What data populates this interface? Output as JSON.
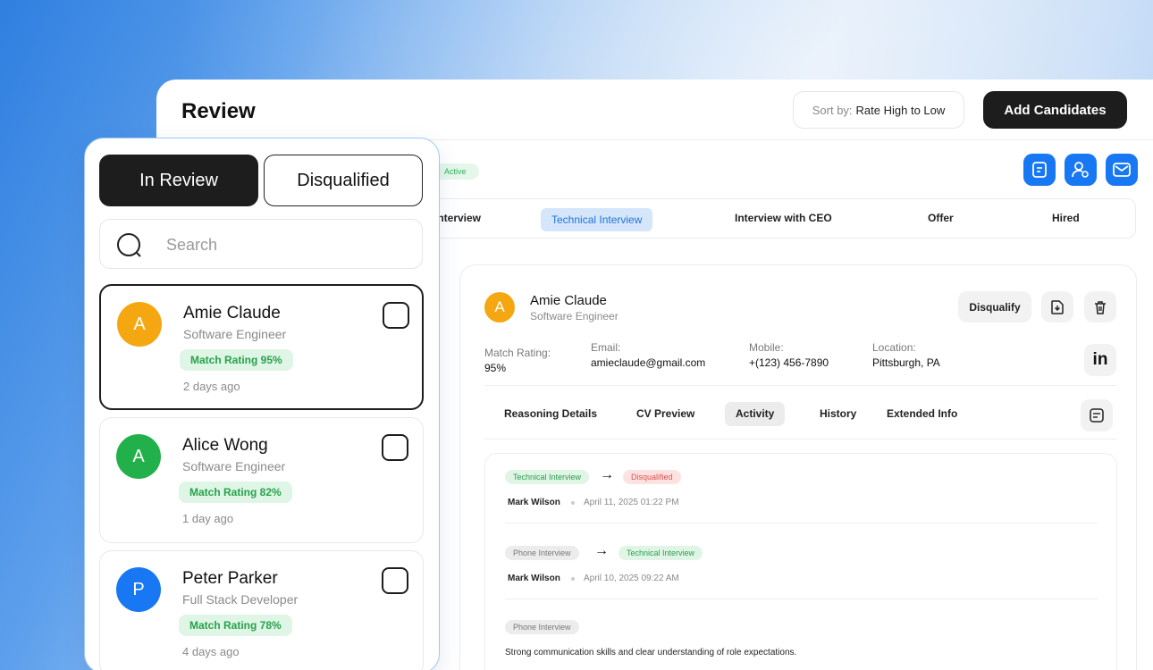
{
  "header": {
    "title": "Review",
    "sort_label": "Sort by:",
    "sort_value": "Rate High to Low",
    "add_button": "Add Candidates"
  },
  "status_badge": "Active",
  "action_icons": [
    "document-icon",
    "user-settings-icon",
    "mail-icon"
  ],
  "stages": [
    {
      "label": "Interview",
      "active": false
    },
    {
      "label": "Technical Interview",
      "active": true
    },
    {
      "label": "Interview with CEO",
      "active": false
    },
    {
      "label": "Offer",
      "active": false
    },
    {
      "label": "Hired",
      "active": false
    }
  ],
  "detail": {
    "avatar_letter": "A",
    "name": "Amie Claude",
    "role": "Software Engineer",
    "disqualify_button": "Disqualify",
    "info": [
      {
        "label": "Match Rating:",
        "value": "95%"
      },
      {
        "label": "Email:",
        "value": "amieclaude@gmail.com"
      },
      {
        "label": "Mobile:",
        "value": "+(123) 456-7890"
      },
      {
        "label": "Location:",
        "value": "Pittsburgh, PA"
      }
    ],
    "linkedin_text": "in",
    "tabs": [
      {
        "label": "Reasoning Details",
        "active": false
      },
      {
        "label": "CV Preview",
        "active": false
      },
      {
        "label": "Activity",
        "active": true
      },
      {
        "label": "History",
        "active": false
      },
      {
        "label": "Extended Info",
        "active": false
      }
    ],
    "activity": [
      {
        "from": "Technical Interview",
        "to": "Disqualified",
        "author": "Mark Wilson",
        "time": "April 11, 2025  01:22 PM"
      },
      {
        "from": "Phone Interview",
        "to": "Technical Interview",
        "author": "Mark Wilson",
        "time": "April 10, 2025  09:22 AM"
      },
      {
        "from": "Phone Interview",
        "comment": "Strong communication skills and clear understanding of role expectations."
      }
    ]
  },
  "panel": {
    "tab_in_review": "In Review",
    "tab_disqualified": "Disqualified",
    "search_placeholder": "Search",
    "candidates": [
      {
        "letter": "A",
        "name": "Amie Claude",
        "role": "Software Engineer",
        "match": "Match Rating 95%",
        "time": "2 days ago",
        "color": "#f5a712"
      },
      {
        "letter": "A",
        "name": "Alice Wong",
        "role": "Software Engineer",
        "match": "Match Rating 82%",
        "time": "1 day ago",
        "color": "#22b04b"
      },
      {
        "letter": "P",
        "name": "Peter Parker",
        "role": "Full Stack Developer",
        "match": "Match Rating 78%",
        "time": "4 days ago",
        "color": "#1877f2"
      }
    ]
  }
}
